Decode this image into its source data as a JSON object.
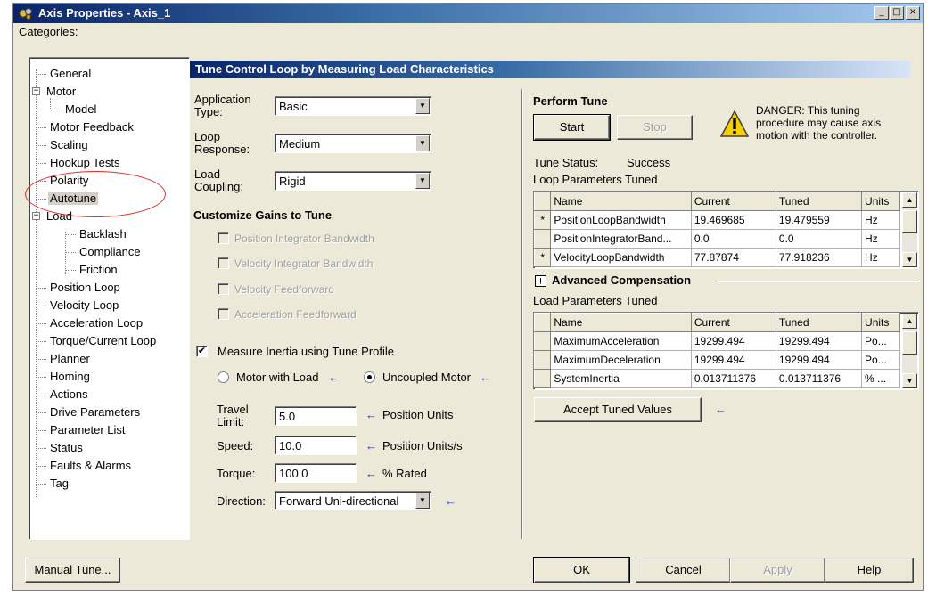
{
  "window": {
    "title": "Axis Properties - Axis_1"
  },
  "categories_label": "Categories:",
  "tree": {
    "items": [
      "General",
      "Motor",
      "Model",
      "Motor Feedback",
      "Scaling",
      "Hookup Tests",
      "Polarity",
      "Autotune",
      "Load",
      "Backlash",
      "Compliance",
      "Friction",
      "Position Loop",
      "Velocity Loop",
      "Acceleration Loop",
      "Torque/Current Loop",
      "Planner",
      "Homing",
      "Actions",
      "Drive Parameters",
      "Parameter List",
      "Status",
      "Faults & Alarms",
      "Tag"
    ],
    "selected": "Autotune"
  },
  "section_title": "Tune Control Loop by Measuring Load Characteristics",
  "app_type": {
    "label": "Application Type:",
    "label_l1": "Application",
    "label_l2": "Type:",
    "value": "Basic"
  },
  "loop_response": {
    "label_l1": "Loop",
    "label_l2": "Response:",
    "value": "Medium"
  },
  "load_coupling": {
    "label_l1": "Load",
    "label_l2": "Coupling:",
    "value": "Rigid"
  },
  "customize": {
    "title": "Customize Gains to Tune",
    "items": [
      "Position Integrator Bandwidth",
      "Velocity Integrator Bandwidth",
      "Velocity Feedforward",
      "Acceleration Feedforward"
    ]
  },
  "measure_inertia": {
    "label": "Measure Inertia using Tune Profile",
    "checked": true,
    "motor_with_load": "Motor with Load",
    "uncoupled_motor": "Uncoupled Motor",
    "selected": "Uncoupled Motor"
  },
  "travel_limit": {
    "label_l1": "Travel",
    "label_l2": "Limit:",
    "value": "5.0",
    "units": "Position Units"
  },
  "speed": {
    "label": "Speed:",
    "value": "10.0",
    "units": "Position Units/s"
  },
  "torque": {
    "label": "Torque:",
    "value": "100.0",
    "units": "% Rated"
  },
  "direction": {
    "label": "Direction:",
    "value": "Forward Uni-directional"
  },
  "perform_tune": {
    "title": "Perform Tune",
    "start": "Start",
    "stop": "Stop",
    "danger": "DANGER: This tuning procedure may cause axis motion with the controller.",
    "status_label": "Tune Status:",
    "status_value": "Success"
  },
  "loop_params": {
    "title": "Loop Parameters Tuned",
    "headers": [
      "Name",
      "Current",
      "Tuned",
      "Units"
    ],
    "rows": [
      {
        "mark": "*",
        "name": "PositionLoopBandwidth",
        "current": "19.469685",
        "tuned": "19.479559",
        "units": "Hz"
      },
      {
        "mark": "",
        "name": "PositionIntegratorBand...",
        "current": "0.0",
        "tuned": "0.0",
        "units": "Hz"
      },
      {
        "mark": "*",
        "name": "VelocityLoopBandwidth",
        "current": "77.87874",
        "tuned": "77.918236",
        "units": "Hz"
      }
    ]
  },
  "advanced": {
    "expander": "+",
    "label": "Advanced Compensation"
  },
  "load_params": {
    "title": "Load Parameters Tuned",
    "headers": [
      "Name",
      "Current",
      "Tuned",
      "Units"
    ],
    "rows": [
      {
        "mark": "",
        "name": "MaximumAcceleration",
        "current": "19299.494",
        "tuned": "19299.494",
        "units": "Po..."
      },
      {
        "mark": "",
        "name": "MaximumDeceleration",
        "current": "19299.494",
        "tuned": "19299.494",
        "units": "Po..."
      },
      {
        "mark": "",
        "name": "SystemInertia",
        "current": "0.013711376",
        "tuned": "0.013711376",
        "units": "% ..."
      }
    ]
  },
  "accept_btn": "Accept Tuned Values",
  "footer": {
    "manual_tune": "Manual Tune...",
    "ok": "OK",
    "cancel": "Cancel",
    "apply": "Apply",
    "help": "Help"
  },
  "arrow_glyph": "←",
  "colors": {
    "title_bar": "#0a246a",
    "header_band": "#3a6ea5",
    "highlight_ellipse": "#e0302a",
    "blue_arrow": "#1f2fd0",
    "warning": "#f5d000"
  }
}
